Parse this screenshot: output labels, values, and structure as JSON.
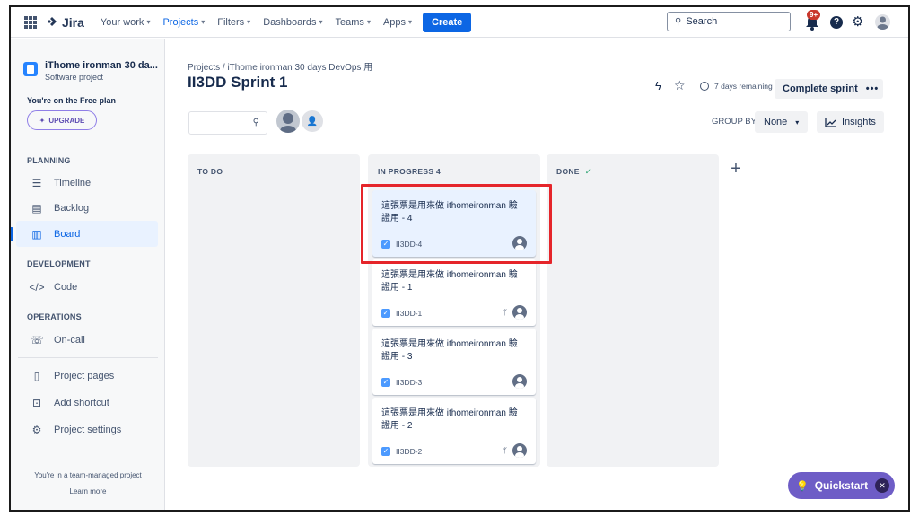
{
  "topnav": {
    "logo": "Jira",
    "items": [
      {
        "label": "Your work"
      },
      {
        "label": "Projects"
      },
      {
        "label": "Filters"
      },
      {
        "label": "Dashboards"
      },
      {
        "label": "Teams"
      },
      {
        "label": "Apps"
      }
    ],
    "create_label": "Create",
    "search_placeholder": "Search",
    "notifications_badge": "9+"
  },
  "sidebar": {
    "project_name": "iThome ironman 30 da...",
    "project_type": "Software project",
    "plan_text": "You're on the Free plan",
    "upgrade_label": "UPGRADE",
    "sections": {
      "planning": "PLANNING",
      "development": "DEVELOPMENT",
      "operations": "OPERATIONS"
    },
    "items": {
      "timeline": "Timeline",
      "backlog": "Backlog",
      "board": "Board",
      "code": "Code",
      "on_call": "On-call",
      "project_pages": "Project pages",
      "add_shortcut": "Add shortcut",
      "project_settings": "Project settings"
    },
    "team_note": "You're in a team-managed project",
    "learn_more": "Learn more"
  },
  "main": {
    "breadcrumb": "Projects  /  iThome ironman 30 days DevOps 用",
    "title": "II3DD Sprint 1",
    "remaining": "7 days remaining",
    "complete_label": "Complete sprint",
    "more_label": "•••",
    "group_by_label": "GROUP BY",
    "group_by_value": "None",
    "insights_label": "Insights"
  },
  "columns": [
    {
      "title": "TO DO"
    },
    {
      "title": "IN PROGRESS 4"
    },
    {
      "title": "DONE"
    }
  ],
  "cards": [
    {
      "text": "這張票是用來做 ithomeironman 驗證用 - 4",
      "key": "II3DD-4"
    },
    {
      "text": "這張票是用來做 ithomeironman 驗證用 - 1",
      "key": "II3DD-1"
    },
    {
      "text": "這張票是用來做 ithomeironman 驗證用 - 3",
      "key": "II3DD-3"
    },
    {
      "text": "這張票是用來做 ithomeironman 驗證用 - 2",
      "key": "II3DD-2"
    }
  ],
  "quickstart_label": "Quickstart",
  "colors": {
    "accent": "#0c66e4",
    "highlight": "#e5252a",
    "quickstart": "#6e5dc6"
  }
}
